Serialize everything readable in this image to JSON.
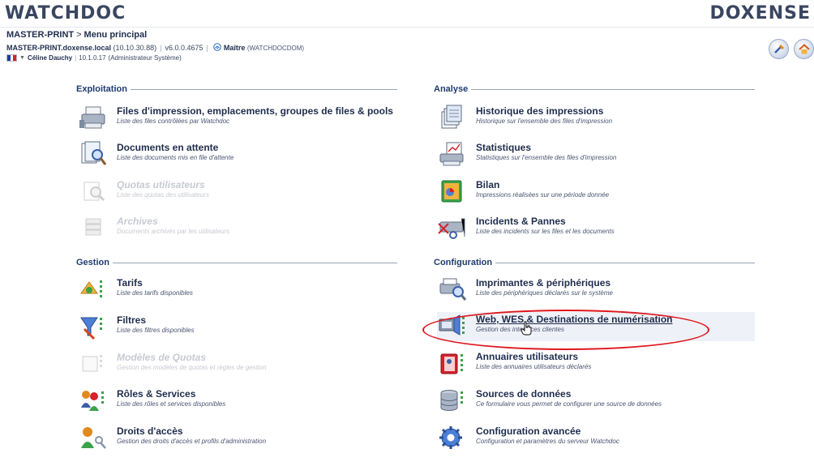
{
  "brand": {
    "left_logo": "WATCHDOC",
    "right_logo": "DOXENSE"
  },
  "breadcrumb": {
    "server": "MASTER-PRINT",
    "separator": ">",
    "page": "Menu principal"
  },
  "server_info": {
    "host": "MASTER-PRINT.doxense.local",
    "ip": "(10.10.30.88)",
    "version": "v6.0.0.4675",
    "role": "Maître",
    "role_domain": "(WATCHDOCDOM)"
  },
  "user_info": {
    "name": "Céline Dauchy",
    "ip": "10.1.0.17",
    "role": "(Administrateur Système)"
  },
  "sections": {
    "exploitation": {
      "title": "Exploitation",
      "items": [
        {
          "title": "Files d'impression, emplacements, groupes de files & pools",
          "subtitle": "Liste des files contrôlées par Watchdoc",
          "icon": "printer-queue-icon",
          "enabled": true
        },
        {
          "title": "Documents en attente",
          "subtitle": "Liste des documents mis en file d'attente",
          "icon": "pending-documents-icon",
          "enabled": true
        },
        {
          "title": "Quotas utilisateurs",
          "subtitle": "Liste des quotas des utilisateurs",
          "icon": "user-quotas-icon",
          "enabled": false
        },
        {
          "title": "Archives",
          "subtitle": "Documents archivés par les utilisateurs",
          "icon": "archives-icon",
          "enabled": false
        }
      ]
    },
    "gestion": {
      "title": "Gestion",
      "items": [
        {
          "title": "Tarifs",
          "subtitle": "Liste des tarifs disponibles",
          "icon": "tariffs-icon",
          "enabled": true
        },
        {
          "title": "Filtres",
          "subtitle": "Liste des filtres disponibles",
          "icon": "filters-icon",
          "enabled": true
        },
        {
          "title": "Modèles de Quotas",
          "subtitle": "Gestion des modèles de quotas et règles de gestion",
          "icon": "quota-models-icon",
          "enabled": false
        },
        {
          "title": "Rôles & Services",
          "subtitle": "Liste des rôles et services disponibles",
          "icon": "roles-services-icon",
          "enabled": true
        },
        {
          "title": "Droits d'accès",
          "subtitle": "Gestion des droits d'accès et profils d'administration",
          "icon": "access-rights-icon",
          "enabled": true
        }
      ]
    },
    "analyse": {
      "title": "Analyse",
      "items": [
        {
          "title": "Historique des impressions",
          "subtitle": "Historique sur l'ensemble des files d'impression",
          "icon": "print-history-icon",
          "enabled": true
        },
        {
          "title": "Statistiques",
          "subtitle": "Statistiques sur l'ensemble des files d'impression",
          "icon": "statistics-icon",
          "enabled": true
        },
        {
          "title": "Bilan",
          "subtitle": "Impressions réalisées sur une période donnée",
          "icon": "report-icon",
          "enabled": true
        },
        {
          "title": "Incidents & Pannes",
          "subtitle": "Liste des incidents sur les files et les documents",
          "icon": "incidents-icon",
          "enabled": true
        }
      ]
    },
    "configuration": {
      "title": "Configuration",
      "items": [
        {
          "title": "Imprimantes & périphériques",
          "subtitle": "Liste des périphériques déclarés sur le système",
          "icon": "printers-devices-icon",
          "enabled": true
        },
        {
          "title": "Web, WES & Destinations de numérisation",
          "subtitle": "Gestion des interfaces clientes",
          "icon": "web-wes-icon",
          "enabled": true
        },
        {
          "title": "Annuaires utilisateurs",
          "subtitle": "Liste des annuaires utilisateurs déclarés",
          "icon": "user-directories-icon",
          "enabled": true
        },
        {
          "title": "Sources de données",
          "subtitle": "Ce formulaire vous permet de configurer une source de données",
          "icon": "data-sources-icon",
          "enabled": true
        },
        {
          "title": "Configuration avancée",
          "subtitle": "Configuration et paramètres du serveur Watchdoc",
          "icon": "advanced-config-icon",
          "enabled": true
        }
      ]
    }
  },
  "colors": {
    "highlight_ellipse": "#e0161e",
    "section_title": "#1f3c6e",
    "text_dark": "#1f2d4d"
  }
}
